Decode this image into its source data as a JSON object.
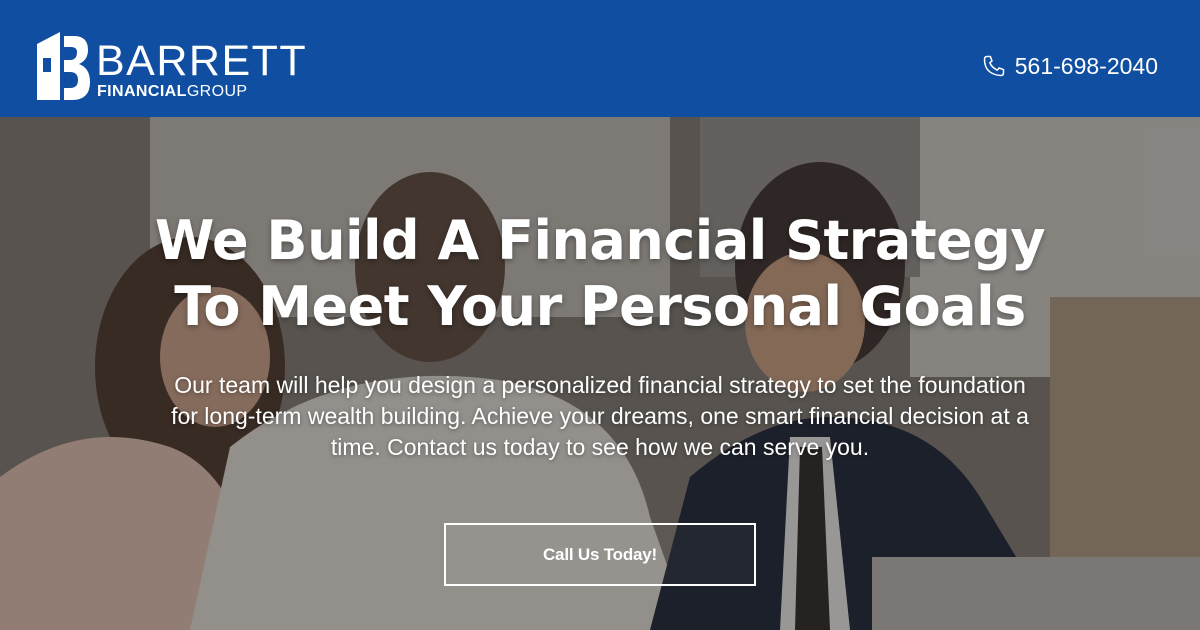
{
  "header": {
    "logo": {
      "icon": "barrett-b-logo-icon",
      "line1": "BARRETT",
      "line2_bold": "FINANCIAL",
      "line2_rest": "GROUP"
    },
    "phone": {
      "icon": "phone-icon",
      "number": "561-698-2040"
    }
  },
  "hero": {
    "headline_line1": "We Build A Financial Strategy",
    "headline_line2": "To Meet Your Personal Goals",
    "subtext": "Our team will help you design a personalized financial strategy to set the foundation for long-term wealth building. Achieve your dreams, one smart financial decision at a time. Contact us today to see how we can serve you.",
    "cta_label": "Call Us Today!"
  },
  "colors": {
    "header_bg": "#0f4ea0",
    "text": "#ffffff"
  }
}
